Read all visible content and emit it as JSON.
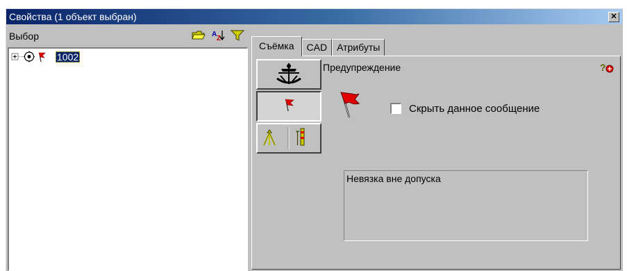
{
  "window": {
    "title": "Свойства (1 объект выбран)"
  },
  "left_panel": {
    "header_label": "Выбор",
    "header_icons": [
      "folder-open-icon",
      "sort-az-icon",
      "filter-icon"
    ],
    "tree": {
      "expander": "+",
      "node_label": "1002"
    }
  },
  "tabs": [
    {
      "label": "Съёмка",
      "active": true
    },
    {
      "label": "CAD",
      "active": false
    },
    {
      "label": "Атрибуты",
      "active": false
    }
  ],
  "tab_content": {
    "section_title": "Предупреждение",
    "hide_checkbox_label": "Скрыть данное сообщение",
    "hide_checkbox_checked": false,
    "message_text": "Невязка вне допуска"
  },
  "colors": {
    "title_start": "#0a246a",
    "title_end": "#a6caf0",
    "face": "#c0c0c0",
    "flag_red": "#e00000"
  }
}
